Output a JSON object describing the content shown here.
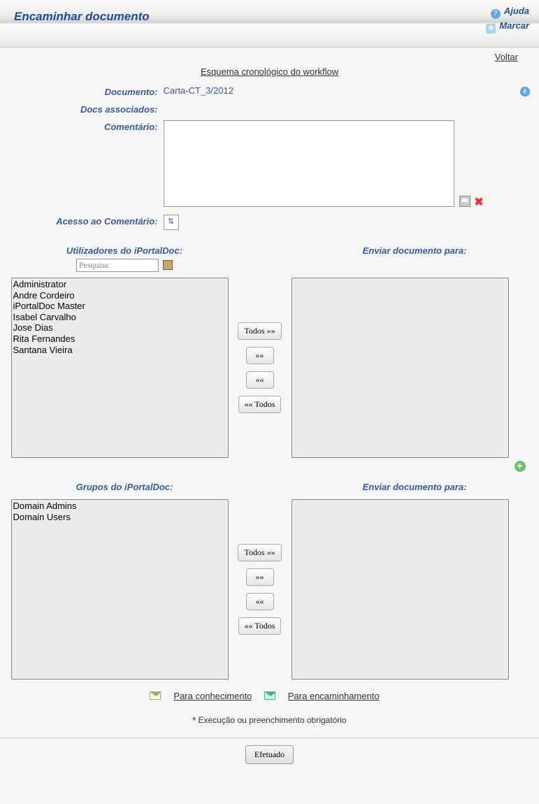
{
  "header": {
    "title": "Encaminhar documento",
    "help": "Ajuda",
    "mark": "Marcar"
  },
  "links": {
    "back": "Voltar",
    "workflow": "Esquema cronológico do workflow",
    "knowledge": "Para conhecimento",
    "forwarding": "Para encaminhamento"
  },
  "form": {
    "document_label": "Documento:",
    "document_value": "Carta-CT_3/2012",
    "assoc_label": "Docs associados:",
    "comment_label": "Comentário:",
    "access_label": "Acesso ao Comentário:"
  },
  "search_placeholder": "Pesquisa",
  "users_section": {
    "title": "Utilizadores do iPortalDoc:",
    "send_to": "Enviar documento para:",
    "available": [
      "Administrator",
      "Andre Cordeiro",
      "iPortalDoc Master",
      "Isabel Carvalho",
      "Jose Dias",
      "Rita Fernandes",
      "Santana Vieira"
    ]
  },
  "groups_section": {
    "title": "Grupos do iPortalDoc:",
    "send_to": "Enviar documento para:",
    "available": [
      "Domain Admins",
      "Domain Users"
    ]
  },
  "buttons": {
    "all_right": "Todos »»",
    "one_right": "»»",
    "one_left": "««",
    "all_left": "«« Todos",
    "submit": "Efetuado"
  },
  "required_text": "Execução ou preenchimento obrigatório"
}
